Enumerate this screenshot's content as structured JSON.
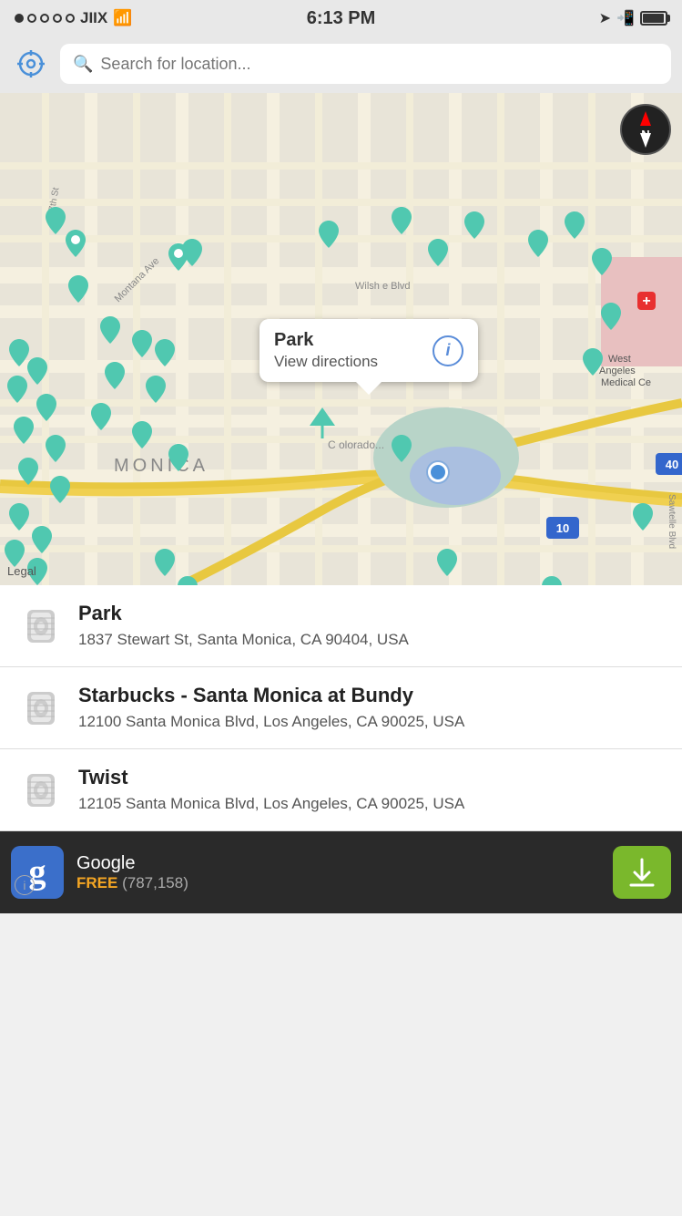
{
  "status_bar": {
    "carrier": "JIIX",
    "time": "6:13 PM",
    "signal_dots": [
      true,
      false,
      false,
      false,
      false
    ]
  },
  "search": {
    "placeholder": "Search for location..."
  },
  "map": {
    "popup": {
      "title": "Park",
      "link": "View directions"
    },
    "legal": "Legal",
    "compass_label": "N"
  },
  "list": {
    "items": [
      {
        "title": "Park",
        "address": "1837 Stewart St, Santa Monica, CA 90404, USA"
      },
      {
        "title": "Starbucks - Santa Monica at Bundy",
        "address": "12100 Santa Monica Blvd, Los Angeles, CA 90025, USA"
      },
      {
        "title": "Twist",
        "address": "12105 Santa Monica Blvd, Los Angeles, CA 90025, USA"
      }
    ]
  },
  "ad": {
    "icon_letter": "g",
    "title": "Google",
    "free_label": "FREE",
    "count": "(787,158)"
  }
}
